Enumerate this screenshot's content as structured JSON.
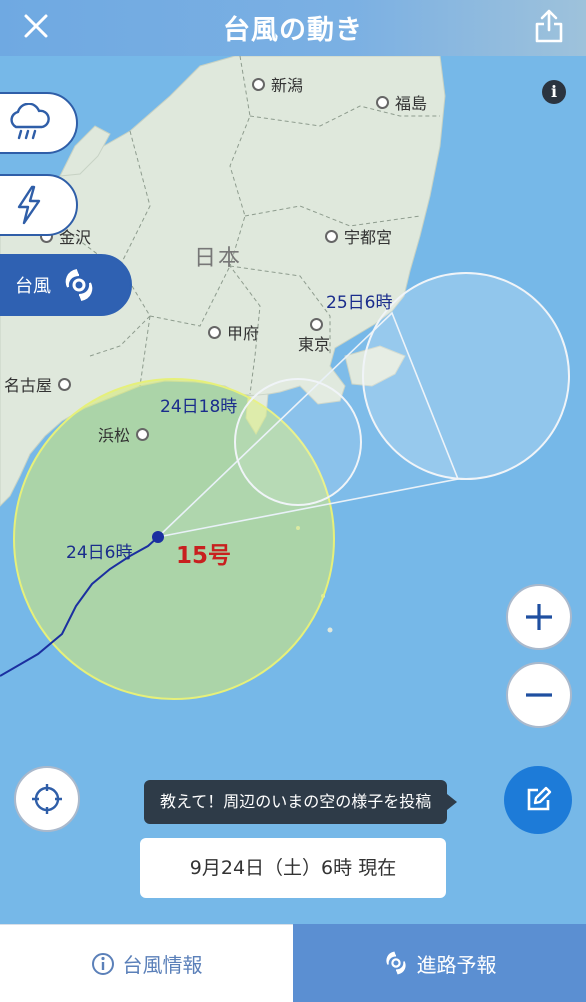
{
  "header": {
    "title": "台風の動き",
    "close_icon": "close-icon",
    "share_icon": "share-icon"
  },
  "map": {
    "country_label": "日本",
    "cities": [
      {
        "name": "新潟"
      },
      {
        "name": "福島"
      },
      {
        "name": "金沢"
      },
      {
        "name": "宇都宮"
      },
      {
        "name": "甲府"
      },
      {
        "name": "東京"
      },
      {
        "name": "名古屋"
      },
      {
        "name": "浜松"
      }
    ],
    "forecast_labels": [
      "24日6時",
      "24日18時",
      "25日6時"
    ],
    "typhoon_number": "15号",
    "colors": {
      "sea": "#76b8e8",
      "land": "#dfe8dc",
      "storm_area": "#d7eb73",
      "forecast_circle": "#ffffff",
      "track": "#1b2fa0"
    }
  },
  "layers": [
    {
      "icon": "rain-cloud-icon",
      "label": ""
    },
    {
      "icon": "lightning-icon",
      "label": ""
    },
    {
      "icon": "typhoon-icon",
      "label": "台風",
      "active": true
    }
  ],
  "controls": {
    "zoom_in": "+",
    "zoom_out": "−",
    "info": "i"
  },
  "post": {
    "prompt": "教えて！周辺のいまの空の様子を投稿",
    "icon": "edit-icon"
  },
  "timestamp": "9月24日（土）6時 現在",
  "tabs": [
    {
      "label": "台風情報",
      "icon": "info-circle-icon",
      "active": false
    },
    {
      "label": "進路予報",
      "icon": "typhoon-icon",
      "active": true
    }
  ]
}
